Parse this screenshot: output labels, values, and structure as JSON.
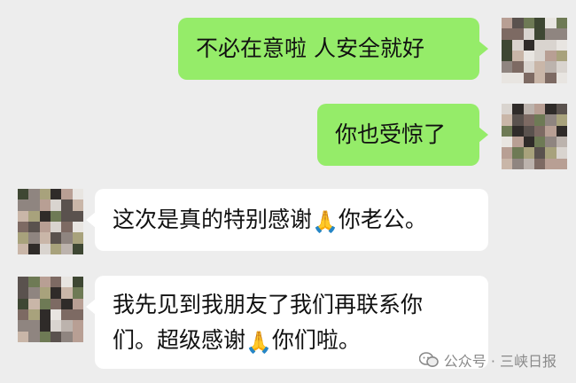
{
  "messages": [
    {
      "side": "out",
      "text": "不必在意啦 人安全就好"
    },
    {
      "side": "out",
      "text": "你也受惊了"
    },
    {
      "side": "in",
      "text_before": "这次是真的特别感谢",
      "emoji": "🙏",
      "text_after": "你老公。"
    },
    {
      "side": "in",
      "line1": "我先见到我朋友了我们再联系你",
      "line2_before": "们。超级感谢",
      "emoji": "🙏",
      "line2_after": "你们啦。"
    }
  ],
  "watermark": {
    "text": "公众号 · 三峡日报",
    "icon": "wechat-official-account-icon"
  },
  "colors": {
    "background": "#ededed",
    "outgoing_bubble": "#95ec69",
    "incoming_bubble": "#ffffff",
    "text": "#111111"
  }
}
